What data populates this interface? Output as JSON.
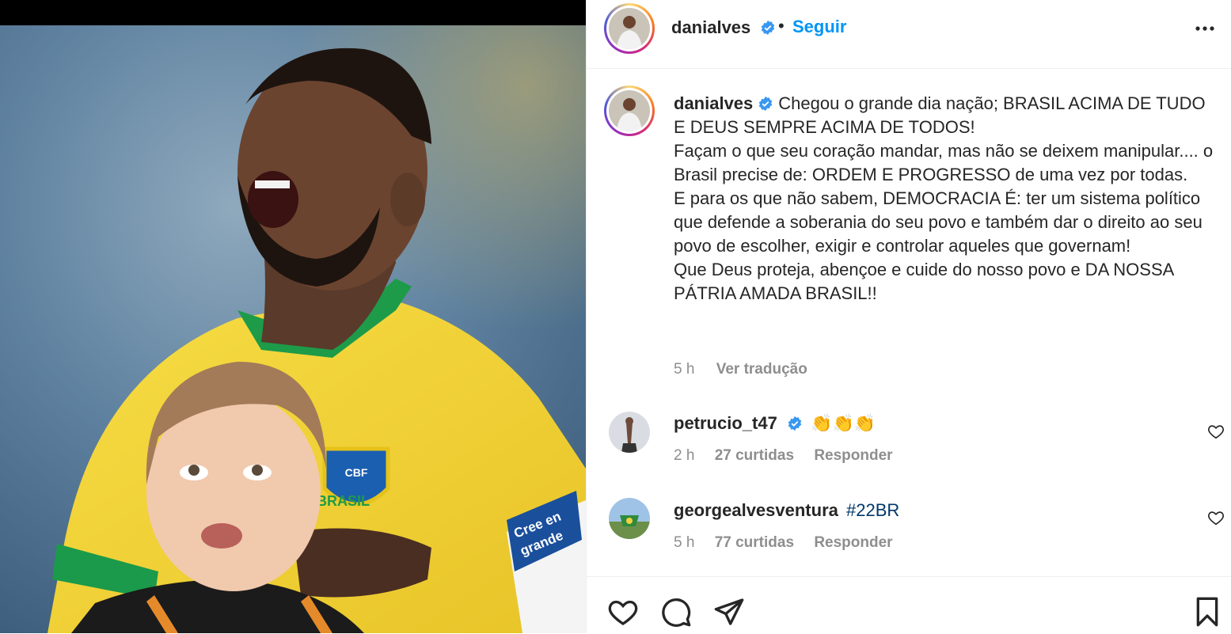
{
  "post": {
    "username": "danialves",
    "follow_label": "Seguir",
    "separator": "•",
    "caption": "Chegou o grande dia nação; BRASIL ACIMA DE TUDO E DEUS SEMPRE ACIMA DE TODOS!\nFaçam o que seu coração mandar, mas não se deixem manipular.... o Brasil precise de: ORDEM E PROGRESSO de uma vez por todas.\nE para os que não sabem, DEMOCRACIA É: ter um sistema político que defende a soberania do seu povo e também dar o direito ao seu povo de escolher, exigir e controlar aqueles que governam!\nQue Deus proteja, abençoe e cuide do nosso povo e DA NOSSA PÁTRIA AMADA BRASIL!!",
    "time": "5 h",
    "translate_label": "Ver tradução"
  },
  "media": {
    "jersey_text": "BRASIL",
    "armband_line1": "Cree en",
    "armband_line2": "grande",
    "crest_text": "CBF"
  },
  "comments": [
    {
      "username": "petrucio_t47",
      "verified": true,
      "text": "👏👏👏",
      "time": "2 h",
      "likes": "27 curtidas",
      "reply": "Responder"
    },
    {
      "username": "georgealvesventura",
      "verified": false,
      "text": "#22BR",
      "time": "5 h",
      "likes": "77 curtidas",
      "reply": "Responder"
    }
  ],
  "icons": {
    "verified": "verified-badge-icon",
    "more": "more-options-icon",
    "like": "heart-icon",
    "comment": "comment-icon",
    "share": "share-icon",
    "save": "bookmark-icon"
  },
  "colors": {
    "link": "#0095f6",
    "verified": "#3897f0",
    "hashtag": "#00376b",
    "muted": "#8e8e8e"
  }
}
